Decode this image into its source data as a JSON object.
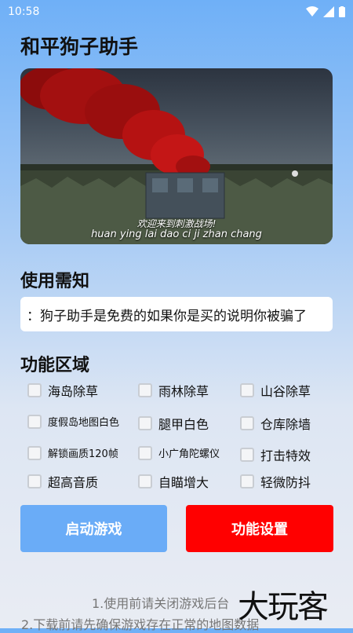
{
  "status_bar": {
    "time": "10:58"
  },
  "app": {
    "title": "和平狗子助手"
  },
  "banner": {
    "subtitle_cn": "欢迎来到刺激战场!",
    "subtitle_pinyin": "huan ying lai dao ci ji zhan chang"
  },
  "notice": {
    "title": "使用需知",
    "text": "：狗子助手是免费的如果你是买的说明你被骗了"
  },
  "features": {
    "title": "功能区域",
    "options": [
      "海岛除草",
      "雨林除草",
      "山谷除草",
      "度假岛地图白色",
      "腿甲白色",
      "仓库除墙",
      "解锁画质120帧",
      "小广角陀螺仪",
      "打击特效",
      "超高音质",
      "自瞄增大",
      "轻微防抖"
    ]
  },
  "buttons": {
    "start": "启动游戏",
    "settings": "功能设置"
  },
  "footer": {
    "line1": "1.使用前请关闭游戏后台",
    "line2": "2.下载前请先确保游戏存在正常的地图数据"
  },
  "watermark": "大玩客",
  "colors": {
    "start_button": "#6aacf7",
    "settings_button": "#ff0000"
  }
}
